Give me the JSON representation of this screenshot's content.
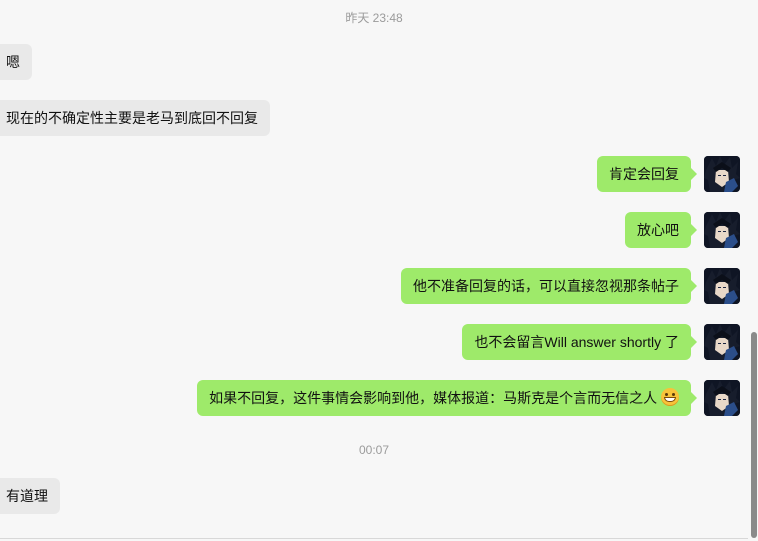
{
  "timestamps": [
    "昨天 23:48",
    "00:07"
  ],
  "messages": [
    {
      "text": "嗯"
    },
    {
      "text": "现在的不确定性主要是老马到底回不回复"
    },
    {
      "text": "肯定会回复"
    },
    {
      "text": "放心吧"
    },
    {
      "text": "他不准备回复的话，可以直接忽视那条帖子"
    },
    {
      "text": "也不会留言Will answer shortly 了"
    },
    {
      "text": "如果不回复，这件事情会影响到他，媒体报道：马斯克是个言而无信之人"
    },
    {
      "text": "有道理"
    }
  ],
  "emoji": "grinning-face-emoji",
  "colors": {
    "incoming_bubble": "#e9e9e9",
    "outgoing_bubble": "#9eea6a",
    "background": "#f7f7f7",
    "timestamp": "#9b9b9b"
  }
}
